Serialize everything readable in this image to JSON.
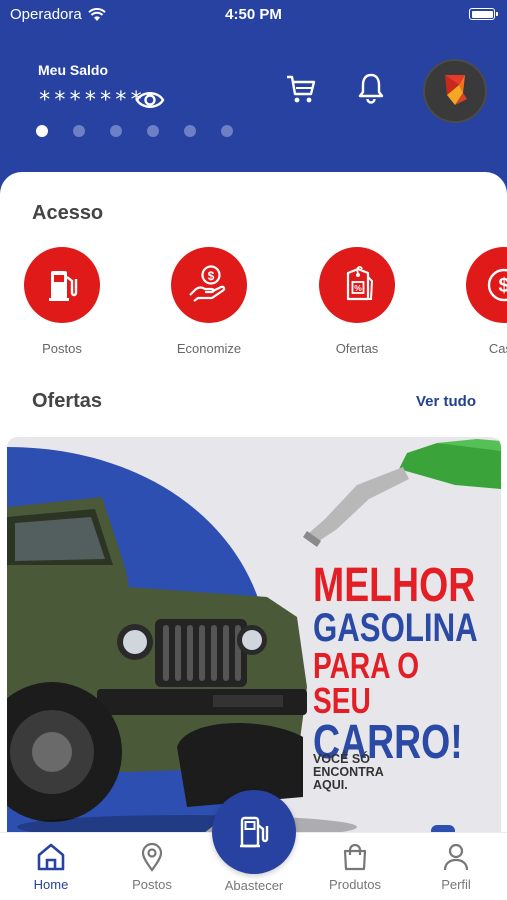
{
  "status_bar": {
    "carrier": "Operadora",
    "time": "4:50 PM"
  },
  "header": {
    "balance_label": "Meu Saldo",
    "balance_value": "*******",
    "carousel": {
      "total": 6,
      "active_index": 0
    }
  },
  "access": {
    "title": "Acesso",
    "items": [
      {
        "label": "Postos",
        "icon": "fuel-pump-icon"
      },
      {
        "label": "Economize",
        "icon": "hand-coin-icon"
      },
      {
        "label": "Ofertas",
        "icon": "price-tag-icon"
      },
      {
        "label": "Cash",
        "icon": "cashback-icon"
      }
    ]
  },
  "offers": {
    "title": "Ofertas",
    "see_all": "Ver tudo",
    "banner": {
      "line1": "MELHOR",
      "line2": "GASOLINA",
      "line3": "PARA O SEU",
      "line4": "CARRO!",
      "tagline": [
        "VOCÊ SÓ",
        "ENCONTRA",
        "AQUI."
      ]
    }
  },
  "bottom_nav": {
    "home": "Home",
    "stations": "Postos",
    "refuel": "Abastecer",
    "products": "Produtos",
    "profile": "Perfil"
  },
  "colors": {
    "primary": "#2742a0",
    "accent_red": "#e01919",
    "fuel_green": "#3aa43a"
  }
}
